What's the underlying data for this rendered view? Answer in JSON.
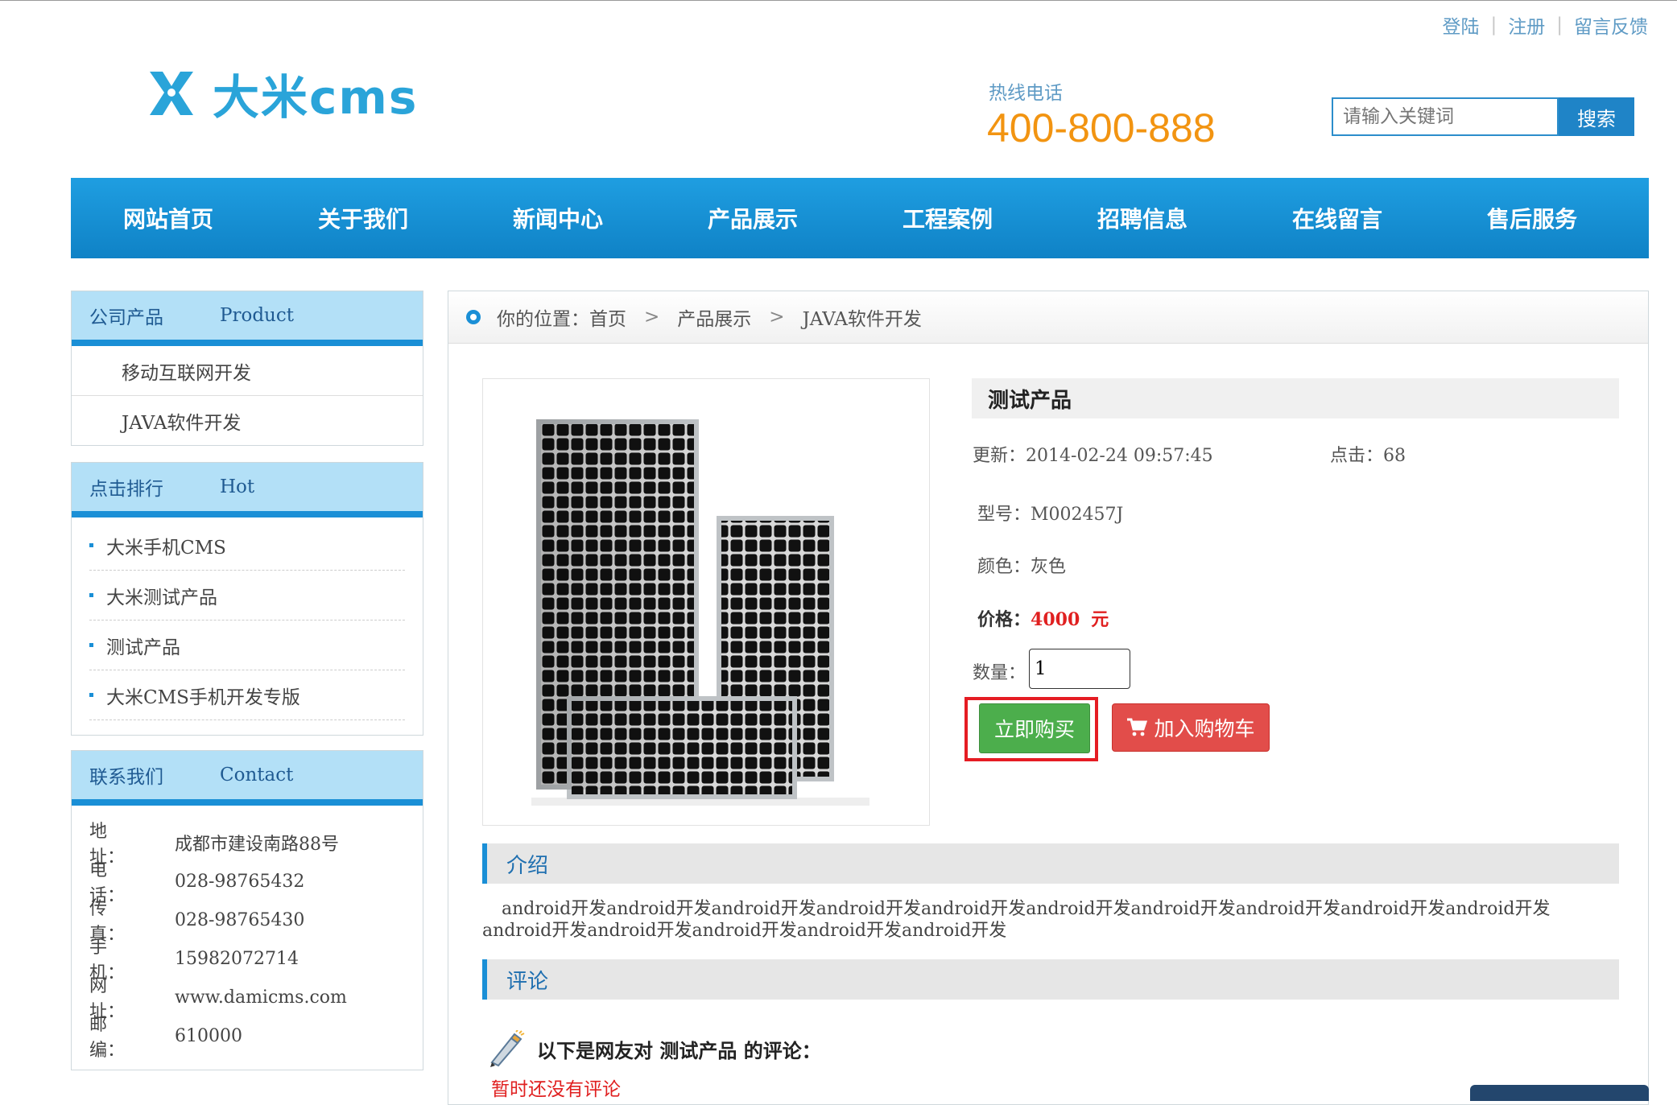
{
  "top_links": [
    "登陆",
    "注册",
    "留言反馈"
  ],
  "logo": {
    "text": "大米cms"
  },
  "hotline": {
    "label": "热线电话",
    "number": "400-800-888"
  },
  "search": {
    "placeholder": "请输入关键词",
    "button": "搜索"
  },
  "nav": [
    "网站首页",
    "关于我们",
    "新闻中心",
    "产品展示",
    "工程案例",
    "招聘信息",
    "在线留言",
    "售后服务"
  ],
  "sidebar": {
    "products": {
      "title": "公司产品",
      "title_en": "Product",
      "items": [
        "移动互联网开发",
        "JAVA软件开发"
      ]
    },
    "hot": {
      "title": "点击排行",
      "title_en": "Hot",
      "items": [
        "大米手机CMS",
        "大米测试产品",
        "测试产品",
        "大米CMS手机开发专版"
      ]
    },
    "contact": {
      "title": "联系我们",
      "title_en": "Contact",
      "rows": [
        {
          "label": "地　　址：",
          "value": "成都市建设南路88号"
        },
        {
          "label": "电　　话：",
          "value": "028-98765432"
        },
        {
          "label": "传　　真：",
          "value": "028-98765430"
        },
        {
          "label": "手　　机：",
          "value": "15982072714"
        },
        {
          "label": "网　　址：",
          "value": "www.damicms.com"
        },
        {
          "label": "邮　　编：",
          "value": "610000"
        }
      ]
    }
  },
  "breadcrumb": {
    "prefix": "你的位置：",
    "items": [
      "首页",
      "产品展示",
      "JAVA软件开发"
    ],
    "sep": ">"
  },
  "product": {
    "title": "测试产品",
    "updated_label": "更新：",
    "updated": "2014-02-24 09:57:45",
    "hits_label": "点击：",
    "hits": "68",
    "model_label": "型号：",
    "model": "M002457J",
    "color_label": "颜色：",
    "color": "灰色",
    "price_label": "价格：",
    "price": "4000",
    "currency": "元",
    "qty_label": "数量：",
    "qty": "1",
    "buy_button": "立即购买",
    "cart_button": "加入购物车"
  },
  "intro": {
    "title": "介绍",
    "text": "android开发android开发android开发android开发android开发android开发android开发android开发android开发android开发android开发android开发android开发android开发android开发"
  },
  "reviews": {
    "title": "评论",
    "heading": "以下是网友对 测试产品 的评论：",
    "empty": "暂时还没有评论"
  },
  "colors": {
    "brand": "#2aa4d9",
    "nav": "#1a8fd6",
    "hotline": "#f29411",
    "price": "#e02020",
    "buy": "#4cae4c",
    "cart": "#e24d4a",
    "highlight": "#e51c23"
  }
}
